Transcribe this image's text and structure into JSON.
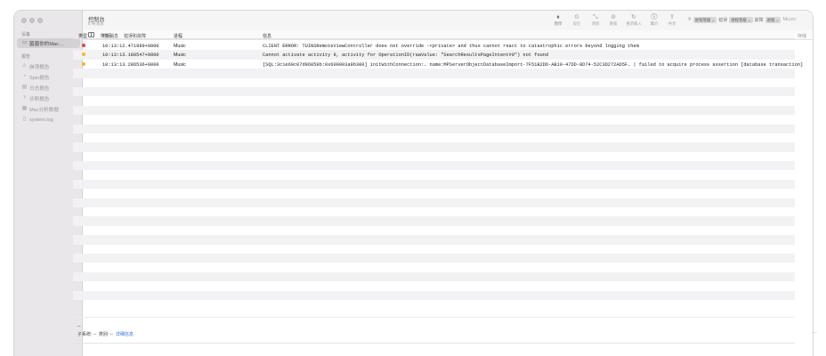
{
  "sidebar": {
    "devices_title": "设备",
    "device_item": "菌菌你的Mac…",
    "reports_title": "报告",
    "reports": [
      {
        "label": "崩溃报告",
        "icon": "warning-icon"
      },
      {
        "label": "Spin报告",
        "icon": "spin-report-icon"
      },
      {
        "label": "日志报告",
        "icon": "document-icon"
      },
      {
        "label": "诊断报告",
        "icon": "diagnostic-icon"
      },
      {
        "label": "Mac分析数据",
        "icon": "analytics-icon"
      },
      {
        "label": "system.log",
        "icon": "log-file-icon"
      }
    ]
  },
  "toolbar": {
    "title": "控制台",
    "subtitle": "5 条消息",
    "buttons": [
      {
        "label": "暂停",
        "icon": "pause-icon"
      },
      {
        "label": "现在",
        "icon": "now-icon"
      },
      {
        "label": "清除",
        "icon": "clear-icon"
      },
      {
        "label": "重载",
        "icon": "reload-icon"
      },
      {
        "label": "重新载入",
        "icon": "refresh-icon"
      },
      {
        "label": "简介",
        "icon": "info-icon"
      },
      {
        "label": "共享",
        "icon": "share-icon"
      }
    ],
    "search": {
      "token1": "进程等级 ⌄",
      "plain1": "错误",
      "token2": "进程等级 ⌄",
      "plain2": "故障",
      "token3": "进程 ⌄",
      "query": "Music"
    }
  },
  "filterbar": {
    "all_messages": "所有消息",
    "errors_faults": "错误和故障",
    "save": "存储"
  },
  "table": {
    "columns": [
      "类型",
      "时间",
      "进程",
      "信息"
    ],
    "rows": [
      {
        "level_color": "#e0443e",
        "time": "10:13:12.471989+0800",
        "process": "Music",
        "message": "CLIENT ERROR: TUINSRemoteViewController does not override -<private> and thus cannot react to catastrophic errors beyond logging them"
      },
      {
        "level_color": "#f5b82e",
        "time": "10:13:13.180547+0800",
        "process": "Music",
        "message": "Cannot activate activity 9, activity for OperationID(rawValue: \"SearchResultsPageIntent#9\") not found"
      },
      {
        "level_color": "#f5b82e",
        "time": "10:13:13.286536+0800",
        "process": "Music",
        "message": "[SQL:3c1e60c07d96059b:0x600003a9b300] initWithConnection:… name:MPServerObjectDatabaseImport-7F51B2DD-AB19-47DD-8D74-52C3D272AD5F… | failed to acquire process assertion [database transaction]"
      }
    ]
  },
  "detail": {
    "title": "--",
    "subsystem_label": "子系统:",
    "subsystem_value": "--",
    "category_label": "类别:",
    "category_value": "--",
    "details_link": "详细信息",
    "more": "···"
  }
}
